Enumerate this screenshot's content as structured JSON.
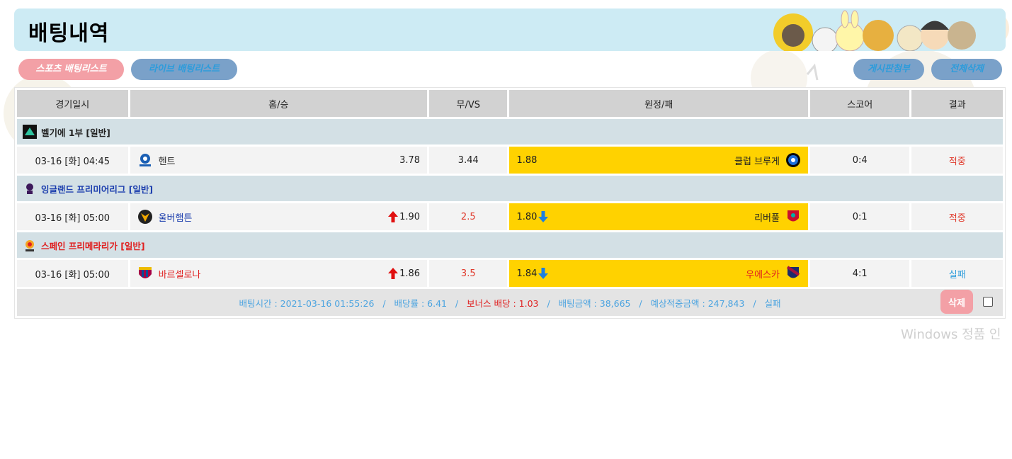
{
  "page": {
    "title": "배팅내역"
  },
  "buttons": {
    "sports_list": "스포츠 배팅리스트",
    "live_list": "라이브 배팅리스트",
    "post_attach": "게시판첨부",
    "delete_all": "전체삭제"
  },
  "table": {
    "headers": [
      "경기일시",
      "홈/승",
      "무/VS",
      "원정/패",
      "스코어",
      "결과"
    ]
  },
  "matches": [
    {
      "league": "벨기에 1부 [일반]",
      "league_color": "#000000",
      "datetime": "03-16 [화] 04:45",
      "home_team": "헨트",
      "home_odds": "3.78",
      "home_arrow": "",
      "draw": "3.44",
      "away_odds": "1.88",
      "away_arrow": "",
      "away_team": "클럽 브루게",
      "score": "0:4",
      "result": "적중"
    },
    {
      "league": "잉글랜드 프리미어리그 [일반]",
      "league_color": "#1d3fae",
      "datetime": "03-16 [화] 05:00",
      "home_team": "울버햄튼",
      "home_odds": "1.90",
      "home_arrow": "up",
      "draw": "2.5",
      "away_odds": "1.80",
      "away_arrow": "down",
      "away_team": "리버풀",
      "score": "0:1",
      "result": "적중"
    },
    {
      "league": "스페인 프리메라리가 [일반]",
      "league_color": "#e02020",
      "datetime": "03-16 [화] 05:00",
      "home_team": "바르셀로나",
      "home_odds": "1.86",
      "home_arrow": "up",
      "draw": "3.5",
      "away_odds": "1.84",
      "away_arrow": "down",
      "away_team": "우에스카",
      "score": "4:1",
      "result": "실패"
    }
  ],
  "summary": {
    "bet_time": "배팅시간 : 2021-03-16 01:55:26",
    "bet_rate": "배당률 : 6.41",
    "bonus": "보너스 배당 : 1.03",
    "bet_amount": "배팅금액 : 38,665",
    "expected": "예상적중금액 : 247,843",
    "status": "실패",
    "sep": "/",
    "delete": "삭제"
  },
  "watermark": "Windows 정품 인"
}
